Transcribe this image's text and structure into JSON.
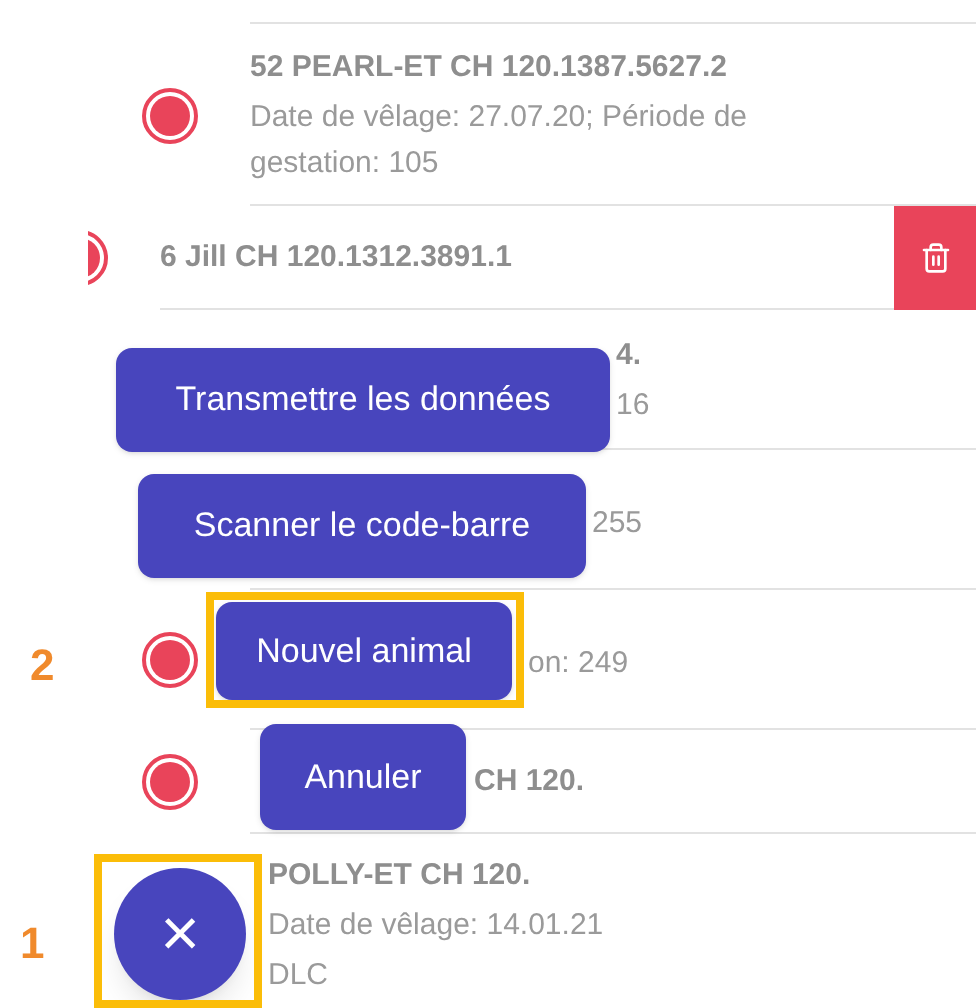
{
  "rows": [
    {
      "kind": "plain",
      "dot": true,
      "title": [
        "52 PEARL-ET CH 120.1387.5627.2"
      ],
      "lines": [
        "Date de vêlage: 27.07.20; Période de gestation: 105"
      ]
    },
    {
      "kind": "swiped",
      "dot": true,
      "title": [
        "6 Jill CH 120.1312.3891.1"
      ],
      "lines": []
    },
    {
      "kind": "plain",
      "dot": false,
      "title": [
        "4."
      ],
      "lines": [
        "16"
      ]
    },
    {
      "kind": "plain",
      "dot": false,
      "title": [],
      "lines": [
        "255"
      ]
    },
    {
      "kind": "plain",
      "dot": true,
      "title": [],
      "lines": [
        "on: 249"
      ]
    },
    {
      "kind": "plain",
      "dot": true,
      "title": [
        "CH 120."
      ],
      "lines": []
    },
    {
      "kind": "plain",
      "dot": false,
      "title": [
        "POLLY-ET CH 120."
      ],
      "lines": [
        "Date de vêlage: 14.01.21",
        "DLC"
      ]
    }
  ],
  "menu": [
    "Transmettre les données",
    "Scanner le code-barre",
    "Nouvel animal",
    "Annuler"
  ],
  "fab": {
    "label": "×"
  },
  "annotations": [
    {
      "label": "2"
    },
    {
      "label": "1"
    }
  ]
}
